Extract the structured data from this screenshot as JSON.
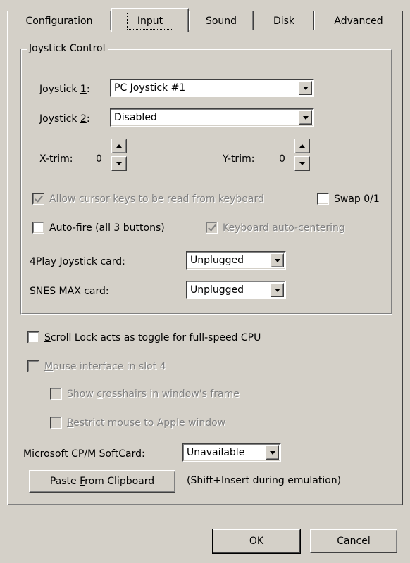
{
  "tabs": [
    {
      "label": "Configuration",
      "selected": false
    },
    {
      "label": "Input",
      "selected": true
    },
    {
      "label": "Sound",
      "selected": false
    },
    {
      "label": "Disk",
      "selected": false
    },
    {
      "label": "Advanced",
      "selected": false
    }
  ],
  "joystick_group": {
    "legend": "Joystick Control",
    "joystick1": {
      "label_pre": "Joystick ",
      "label_mnemonic": "1",
      "label_post": ":",
      "value": "PC Joystick #1"
    },
    "joystick2": {
      "label_pre": "Joystick ",
      "label_mnemonic": "2",
      "label_post": ":",
      "value": "Disabled"
    },
    "xtrim": {
      "label_mnemonic": "X",
      "label_post": "-trim:",
      "value": "0"
    },
    "ytrim": {
      "label_mnemonic": "Y",
      "label_post": "-trim:",
      "value": "0"
    },
    "allow_cursor_keys": {
      "label": "Allow cursor keys to be read from keyboard",
      "checked": true,
      "enabled": false
    },
    "swap01": {
      "label": "Swap 0/1",
      "checked": false,
      "enabled": true
    },
    "autofire": {
      "label": "Auto-fire (all 3 buttons)",
      "checked": false,
      "enabled": true
    },
    "keyboard_autocentering": {
      "label": "Keyboard auto-centering",
      "checked": true,
      "enabled": false
    },
    "fourplay": {
      "label": "4Play Joystick card:",
      "value": "Unplugged"
    },
    "snesmax": {
      "label": "SNES MAX card:",
      "value": "Unplugged"
    }
  },
  "options": {
    "scroll_lock": {
      "label_mnemonic": "S",
      "label_post": "croll Lock acts as toggle for full-speed CPU",
      "checked": false,
      "enabled": true
    },
    "mouse_interface": {
      "label_mnemonic": "M",
      "label_post": "ouse interface in slot 4",
      "checked": false,
      "enabled": false
    },
    "show_crosshairs": {
      "label_pre": "Show ",
      "label_mnemonic": "c",
      "label_post": "rosshairs in window's frame",
      "checked": false,
      "enabled": false
    },
    "restrict_mouse": {
      "label_mnemonic": "R",
      "label_post": "estrict mouse to Apple window",
      "checked": false,
      "enabled": false
    },
    "softcard": {
      "label": "Microsoft CP/M SoftCard:",
      "value": "Unavailable"
    },
    "paste_button": {
      "label_pre": "Paste ",
      "label_mnemonic": "F",
      "label_post": "rom Clipboard"
    },
    "paste_hint": "(Shift+Insert during emulation)"
  },
  "footer": {
    "ok_label": "OK",
    "cancel_label": "Cancel"
  },
  "colors": {
    "face": "#d4d0c8",
    "shadow": "#808080",
    "dark": "#404040",
    "light": "#ffffff",
    "text": "#000000",
    "disabled_text": "#808080",
    "field": "#ffffff"
  }
}
